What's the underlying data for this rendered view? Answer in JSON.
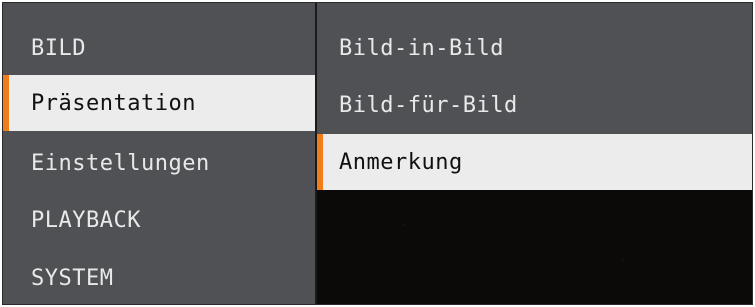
{
  "colors": {
    "panel_bg": "#4f5154",
    "selected_bg": "#ececec",
    "accent": "#f07d1a",
    "text": "#e9e9e9",
    "selected_text": "#111111",
    "background": "#0b0a08"
  },
  "main_menu": {
    "items": [
      {
        "label": "BILD",
        "selected": false
      },
      {
        "label": "Präsentation",
        "selected": true
      },
      {
        "label": "Einstellungen",
        "selected": false
      },
      {
        "label": "PLAYBACK",
        "selected": false
      },
      {
        "label": "SYSTEM",
        "selected": false
      }
    ]
  },
  "submenu": {
    "items": [
      {
        "label": "Bild-in-Bild",
        "selected": false
      },
      {
        "label": "Bild-für-Bild",
        "selected": false
      },
      {
        "label": "Anmerkung",
        "selected": true
      }
    ]
  }
}
